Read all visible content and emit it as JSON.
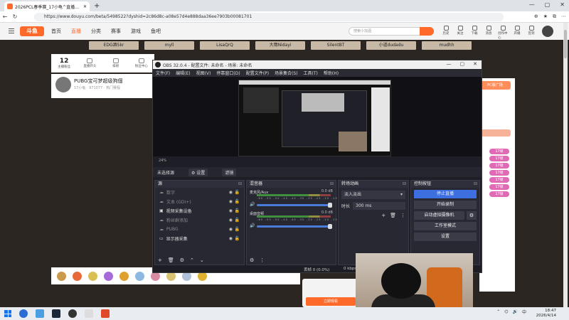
{
  "browser": {
    "tab_title": "2026PCL春季赛_17小龟^直播_17斗鱼",
    "url": "https://www.douyu.com/beta/5498522?dyshid=2c86d8c-a08e57d4e888daa36ee7903b00081701",
    "new_tab": "+",
    "window_controls": [
      "—",
      "▢",
      "✕"
    ]
  },
  "site": {
    "logo": "斗鱼",
    "nav": [
      "首页",
      "直播",
      "分类",
      "赛事",
      "游戏",
      "鱼吧"
    ],
    "nav_active": "直播",
    "search_placeholder": "搜索小加酒",
    "top_icons": [
      "历史",
      "关注",
      "下载",
      "消息",
      "创作中心",
      "开播",
      "签到"
    ],
    "name_tags": [
      "EDG酒5kr",
      "myll",
      "LisaQrQ",
      "大隋Nidayi",
      "SilentBT",
      "小道dudadu",
      "mudhh"
    ],
    "counters": [
      {
        "value": "12",
        "label": "主播粉丝"
      },
      {
        "value": "",
        "label": "直播开头"
      },
      {
        "value": "",
        "label": "排榜"
      },
      {
        "value": "",
        "label": "粉丝中心"
      }
    ],
    "room_title": "PUBG宝可梦超级狗個",
    "room_sub": "17小龟 · 971077 · 热门赛程",
    "chat_badge": "PC版广场",
    "chat_pills": [
      "17级",
      "17级",
      "17级",
      "17级",
      "17级",
      "17级",
      "17级"
    ],
    "live_button": "立即观看"
  },
  "obs": {
    "title": "OBS 32.0.4 - 配置文件: 未命名 - 场景: 未命名",
    "menu": [
      "文件(F)",
      "编辑(E)",
      "视图(V)",
      "停靠窗口(D)",
      "配置文件(P)",
      "场景集合(S)",
      "工具(T)",
      "帮助(H)"
    ],
    "zoom": "24%",
    "no_source": "未选择源",
    "properties": "⚙ 设置",
    "filters": "滤镜",
    "sources_header": "源",
    "sources": [
      {
        "name": "数字",
        "dim": true
      },
      {
        "name": "文本 (GDI+)",
        "dim": true
      },
      {
        "name": "视频采集设备",
        "dim": false
      },
      {
        "name": "粉丝群添加",
        "dim": true
      },
      {
        "name": "PUBG",
        "dim": true
      },
      {
        "name": "显示器采集",
        "dim": false
      }
    ],
    "mixer_header": "混音器",
    "mixer": [
      {
        "name": "麦克风/Aux",
        "db": "0.0 dB"
      },
      {
        "name": "桌面音频",
        "db": "0.0 dB"
      }
    ],
    "meter_scale": "-60 -55 -50 -45 -40 -35 -30 -25 -20 -15 -10 -5 0",
    "transitions_header": "转场动画",
    "transition": "淡入淡出",
    "duration_label": "时长",
    "duration": "300 ms",
    "controls_header": "控制按钮",
    "controls": {
      "stop_stream": "停止直播",
      "start_record": "开始录制",
      "virtual_cam": "启动虚拟摄像机",
      "studio_mode": "工作室模式",
      "settings": "设置"
    },
    "status_dropped": "丢帧 0 (0.0%)",
    "status_kbps": "0 kbps"
  },
  "taskbar": {
    "time": "18:47",
    "date": "2026/4/14",
    "lang": "中"
  }
}
